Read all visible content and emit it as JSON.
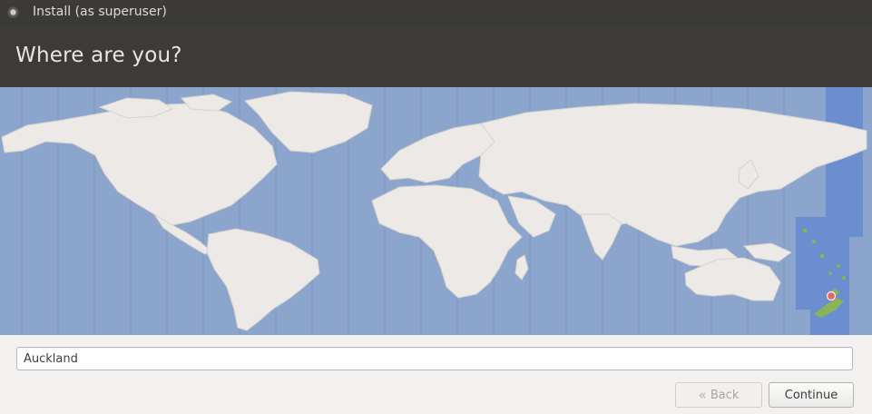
{
  "window": {
    "title": "Install (as superuser)",
    "close_icon": "close-icon"
  },
  "header": {
    "title": "Where are you?"
  },
  "map": {
    "selected_zone_color": "#6a8ed0",
    "ocean_color": "#8ca5cc",
    "land_color": "#ece9e6",
    "marker_color": "#e06a6a",
    "highlight_land_color": "#8ab35a"
  },
  "location": {
    "value": "Auckland",
    "placeholder": ""
  },
  "buttons": {
    "back_label": "Back",
    "back_icon": "chevron-left-icon",
    "continue_label": "Continue"
  }
}
